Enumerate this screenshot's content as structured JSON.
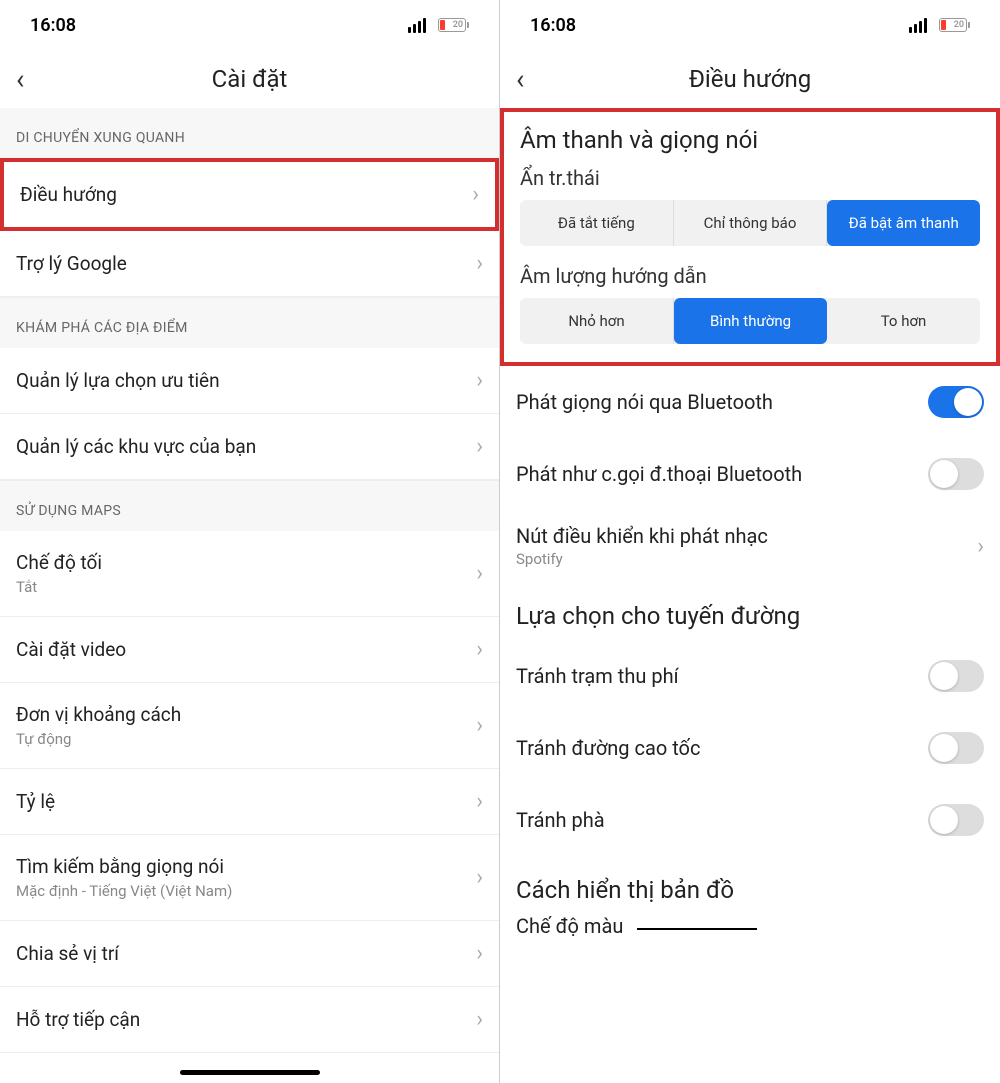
{
  "status": {
    "time": "16:08",
    "battery": "20"
  },
  "left": {
    "title": "Cài đặt",
    "sections": [
      {
        "header": "DI CHUYỂN XUNG QUANH",
        "items": [
          {
            "title": "Điều hướng",
            "highlight": true
          },
          {
            "title": "Trợ lý Google"
          }
        ]
      },
      {
        "header": "KHÁM PHÁ CÁC ĐỊA ĐIỂM",
        "items": [
          {
            "title": "Quản lý lựa chọn ưu tiên"
          },
          {
            "title": "Quản lý các khu vực của bạn"
          }
        ]
      },
      {
        "header": "SỬ DỤNG MAPS",
        "items": [
          {
            "title": "Chế độ tối",
            "sub": "Tắt"
          },
          {
            "title": "Cài đặt video"
          },
          {
            "title": "Đơn vị khoảng cách",
            "sub": "Tự động"
          },
          {
            "title": "Tỷ lệ"
          },
          {
            "title": "Tìm kiếm bằng giọng nói",
            "sub": "Mặc định - Tiếng Việt (Việt Nam)"
          },
          {
            "title": "Chia sẻ vị trí"
          },
          {
            "title": "Hỗ trợ tiếp cận"
          }
        ]
      }
    ]
  },
  "right": {
    "title": "Điều hướng",
    "sound_section": {
      "heading": "Âm thanh và giọng nói",
      "status_label": "Ẩn tr.thái",
      "status_options": [
        "Đã tắt tiếng",
        "Chỉ thông báo",
        "Đã bật âm thanh"
      ],
      "status_active": 2,
      "volume_label": "Âm lượng hướng dẫn",
      "volume_options": [
        "Nhỏ hơn",
        "Bình thường",
        "To hơn"
      ],
      "volume_active": 1
    },
    "toggles": [
      {
        "label": "Phát giọng nói qua Bluetooth",
        "on": true
      },
      {
        "label": "Phát như c.gọi đ.thoại Bluetooth",
        "on": false
      }
    ],
    "music_control": {
      "title": "Nút điều khiển khi phát nhạc",
      "sub": "Spotify"
    },
    "route_section": {
      "heading": "Lựa chọn cho tuyến đường",
      "items": [
        {
          "label": "Tránh trạm thu phí",
          "on": false
        },
        {
          "label": "Tránh đường cao tốc",
          "on": false
        },
        {
          "label": "Tránh phà",
          "on": false
        }
      ]
    },
    "map_section": {
      "heading": "Cách hiển thị bản đồ",
      "color_label": "Chế độ màu"
    }
  }
}
